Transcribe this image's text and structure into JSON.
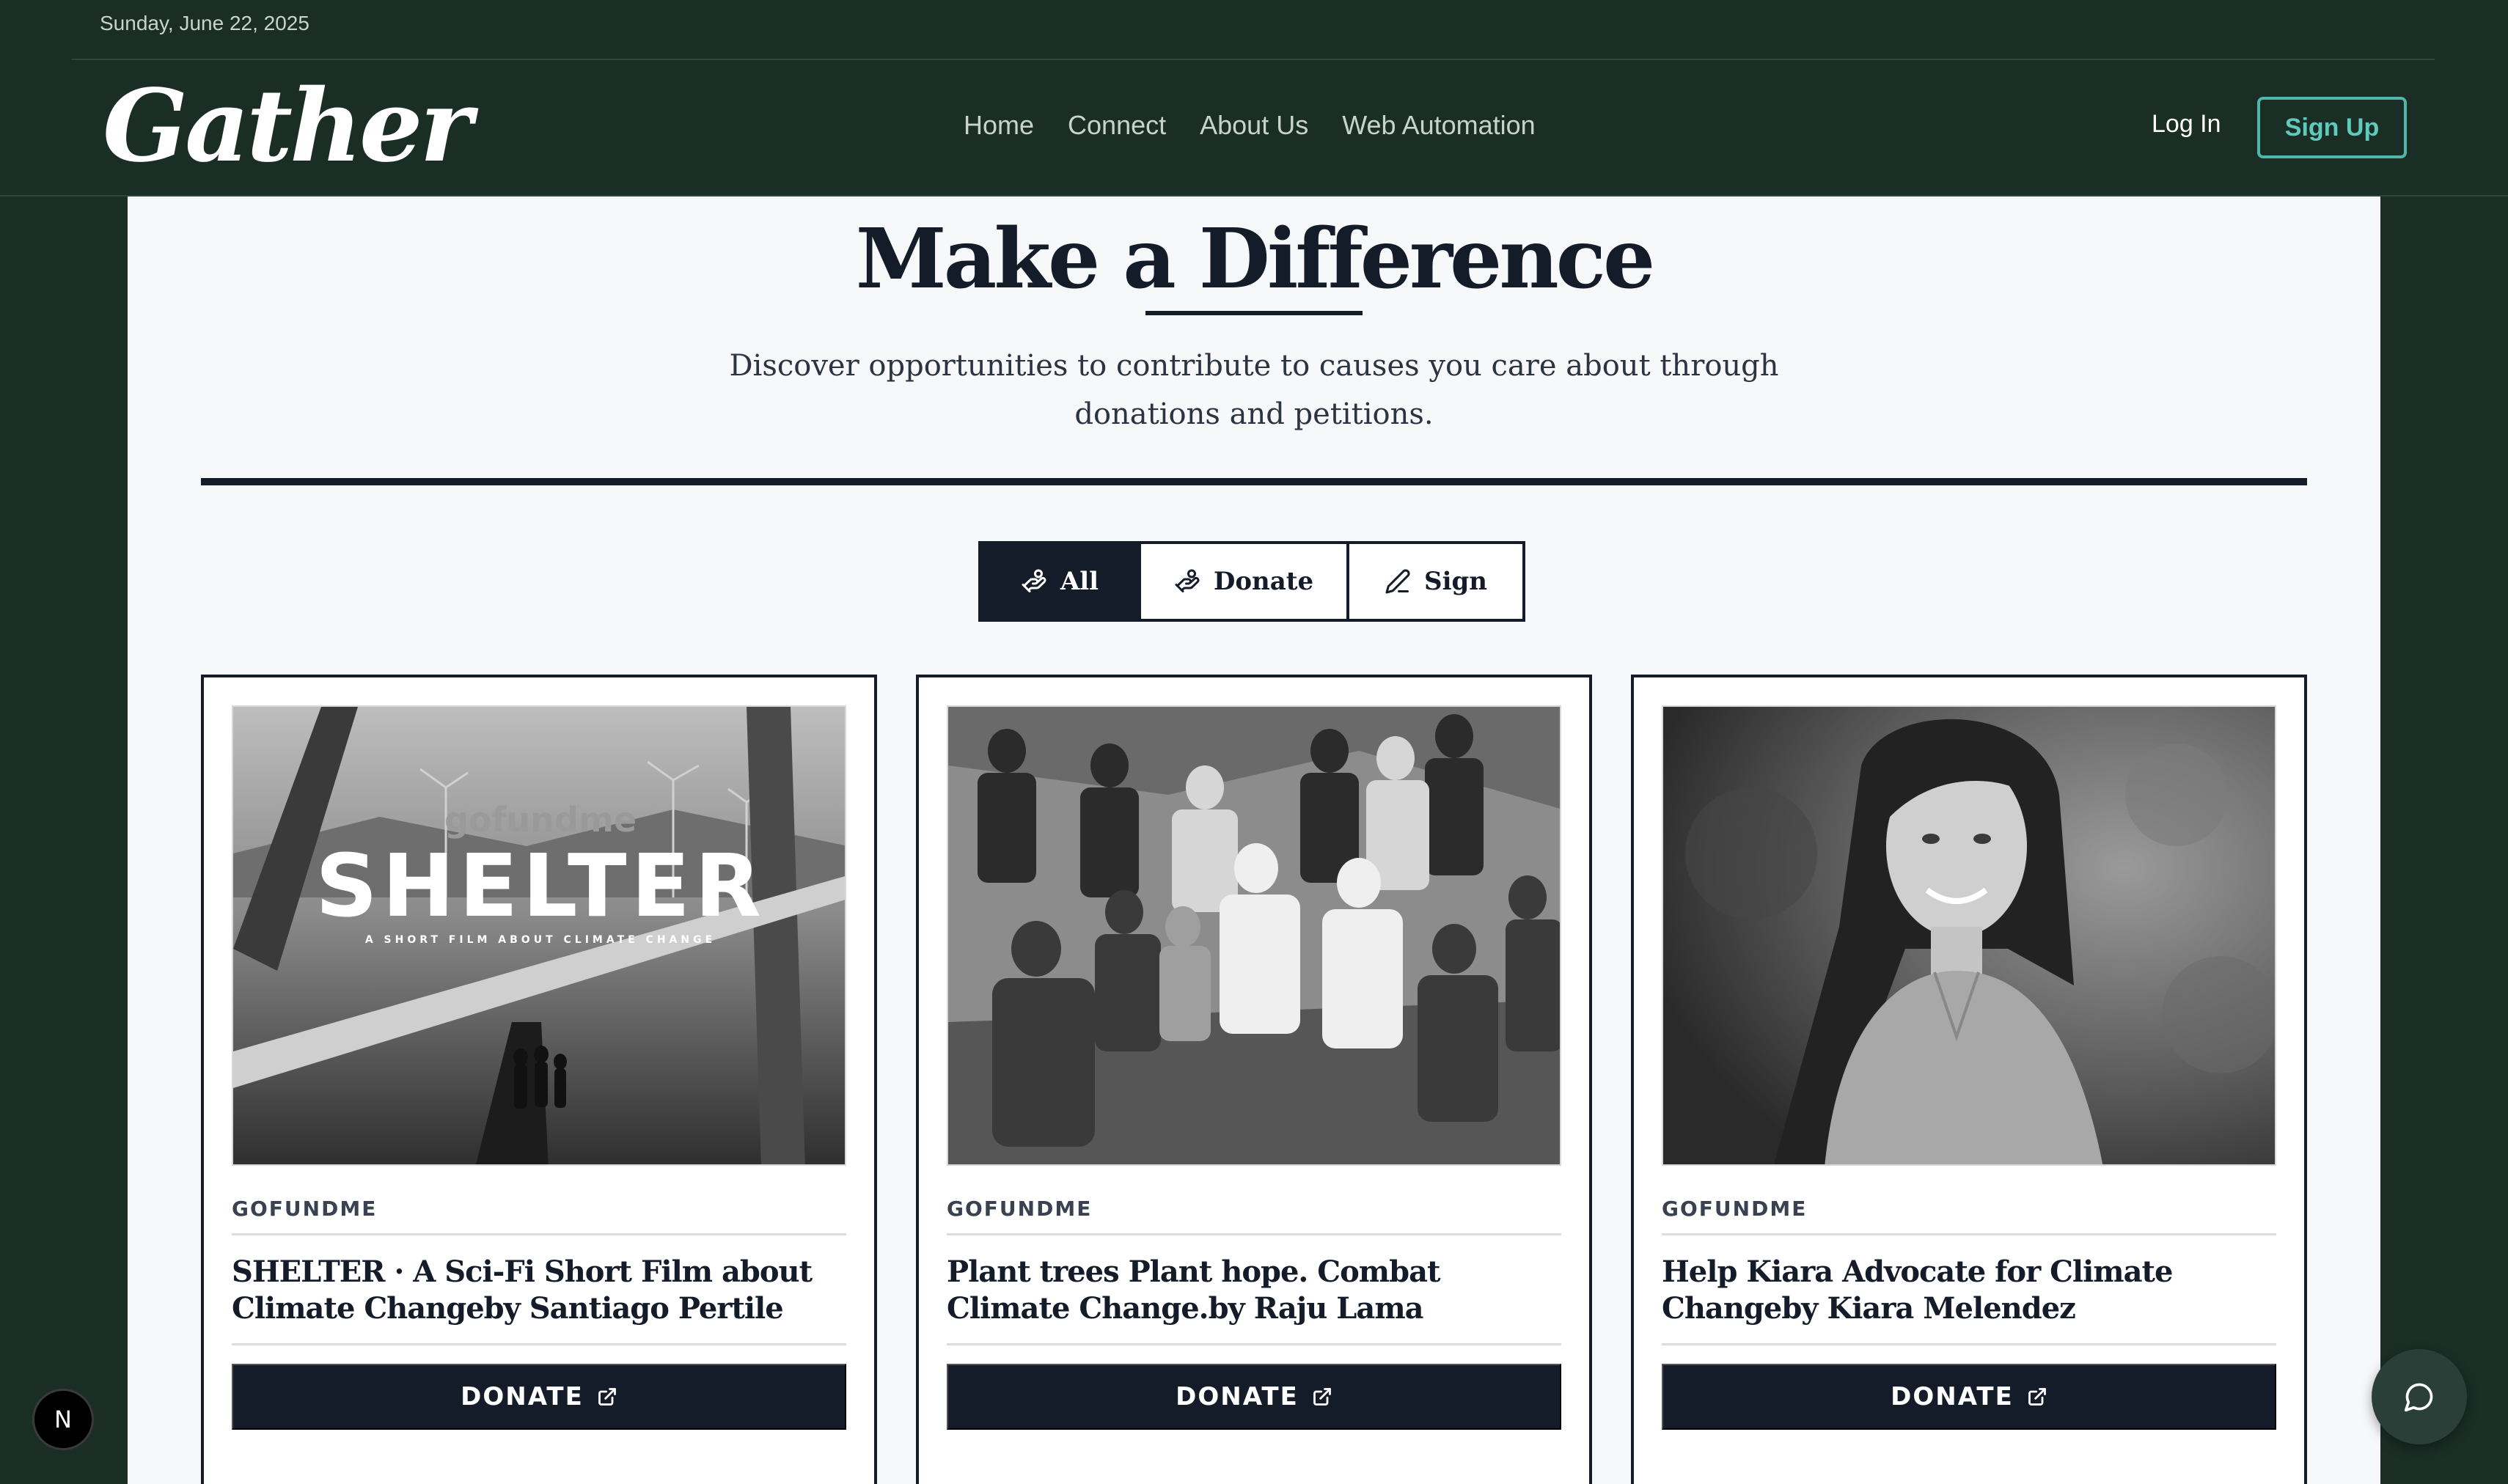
{
  "topbar": {
    "date": "Sunday, June 22, 2025"
  },
  "header": {
    "logo": "Gather",
    "nav": [
      "Home",
      "Connect",
      "About Us",
      "Web Automation"
    ],
    "login": "Log In",
    "signup": "Sign Up"
  },
  "hero": {
    "title": "Make a Difference",
    "subtitle": "Discover opportunities to contribute to causes you care about through donations and petitions."
  },
  "filters": {
    "all": "All",
    "donate": "Donate",
    "sign": "Sign",
    "selected": "All"
  },
  "cards": [
    {
      "source": "GOFUNDME",
      "title": "SHELTER · A Sci-Fi Short Film about Climate Changeby Santiago Pertile",
      "button": "DONATE",
      "image_text": "gofundme",
      "image_title": "SHELTER",
      "image_tagline": "A SHORT FILM ABOUT CLIMATE CHANGE"
    },
    {
      "source": "GOFUNDME",
      "title": "Plant trees Plant hope. Combat Climate Change.by Raju Lama",
      "button": "DONATE"
    },
    {
      "source": "GOFUNDME",
      "title": "Help Kiara Advocate for Climate Changeby Kiara Melendez",
      "button": "DONATE"
    }
  ],
  "widgets": {
    "next_badge": "N"
  },
  "colors": {
    "background": "#1a2e26",
    "panel": "#f7f8fa",
    "navy": "#141b29",
    "accent": "#4fb8aa"
  }
}
